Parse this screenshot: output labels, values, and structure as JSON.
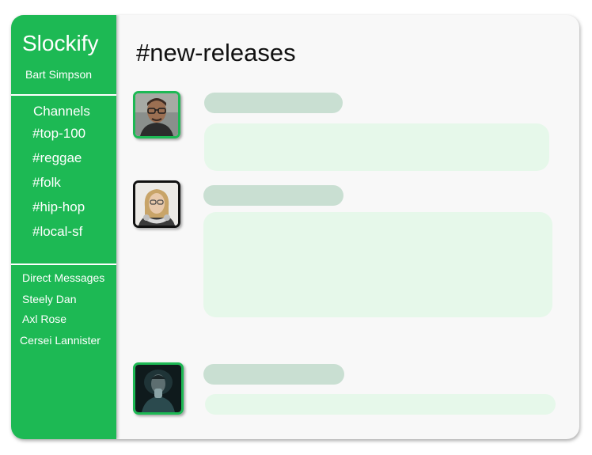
{
  "app": {
    "brand": "Slockify",
    "user_name": "Bart Simpson"
  },
  "sidebar": {
    "channels_heading": "Channels",
    "channels": [
      "#top-100",
      "#reggae",
      "#folk",
      "#hip-hop",
      "#local-sf"
    ],
    "dm_heading": "Direct Messages",
    "direct_messages": [
      "Steely Dan",
      "Axl Rose",
      "Cersei Lannister"
    ]
  },
  "main": {
    "channel_title": "#new-releases",
    "messages": [
      {
        "avatar": "man-with-glasses-avatar",
        "border_color": "#1db954"
      },
      {
        "avatar": "woman-with-headphones-avatar",
        "border_color": "#111111"
      },
      {
        "avatar": "man-in-dark-avatar",
        "border_color": "#1db954"
      }
    ]
  },
  "colors": {
    "brand_green": "#1db954",
    "name_placeholder": "#c9dfd2",
    "message_placeholder": "#e6f8ea",
    "panel_background": "#f8f8f8"
  }
}
